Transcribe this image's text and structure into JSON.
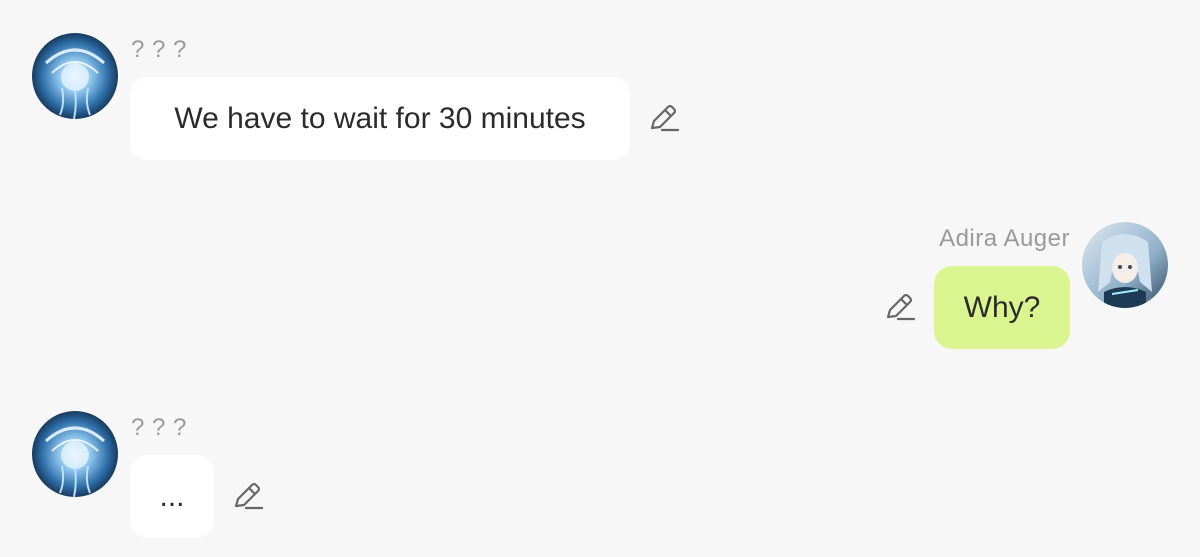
{
  "messages": [
    {
      "sender": "? ? ?",
      "text": "We have to wait for 30 minutes",
      "side": "incoming",
      "avatar_icon": "jellyfish-avatar-icon",
      "edit_icon": "pencil-icon"
    },
    {
      "sender": "Adira Auger",
      "text": "Why?",
      "side": "outgoing",
      "avatar_icon": "anime-girl-avatar-icon",
      "edit_icon": "pencil-icon"
    },
    {
      "sender": "? ? ?",
      "text": "...",
      "side": "incoming",
      "avatar_icon": "jellyfish-avatar-icon",
      "edit_icon": "pencil-icon"
    }
  ],
  "colors": {
    "background": "#f7f7f7",
    "incoming_bubble": "#ffffff",
    "outgoing_bubble": "#daf58f",
    "sender_name": "#9a9a9a",
    "message_text": "#2b2b2b",
    "icon": "#666666"
  }
}
